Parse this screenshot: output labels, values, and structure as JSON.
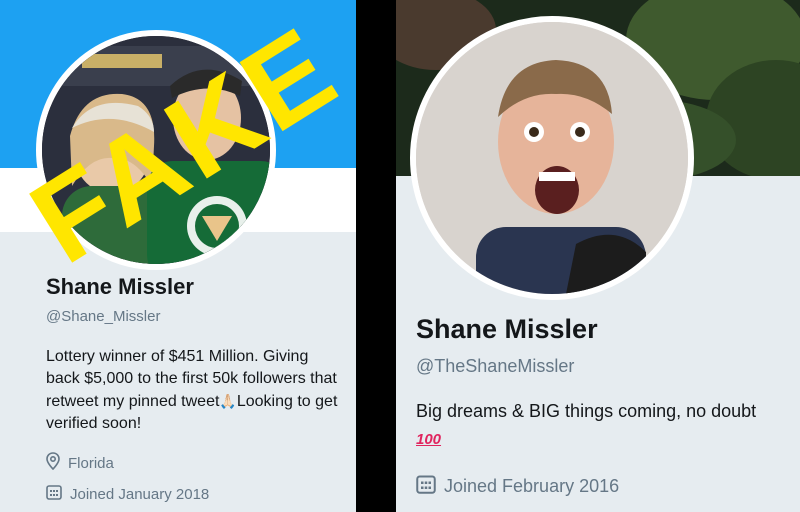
{
  "left_card": {
    "stamp": "FAKE",
    "name": "Shane Missler",
    "handle": "@Shane_Missler",
    "bio_part1": "Lottery winner of $451 Million. Giving back $5,000 to the first 50k followers that retweet my pinned tweet",
    "bio_emoji": "🙏🏻",
    "bio_part2": "Looking to get verified soon!",
    "location": "Florida",
    "joined": "Joined January 2018",
    "banner_color": "#1da1f2",
    "location_icon": "map-pin-icon",
    "calendar_icon": "calendar-icon"
  },
  "right_card": {
    "name": "Shane Missler",
    "handle": "@TheShaneMissler",
    "bio_text": "Big dreams & BIG things coming, no doubt",
    "bio_emoji": "100",
    "joined": "Joined February 2016",
    "calendar_icon": "calendar-icon"
  },
  "colors": {
    "stamp": "#ffe600",
    "body": "#e6ecf0",
    "text_primary": "#14171a",
    "text_secondary": "#657786"
  }
}
